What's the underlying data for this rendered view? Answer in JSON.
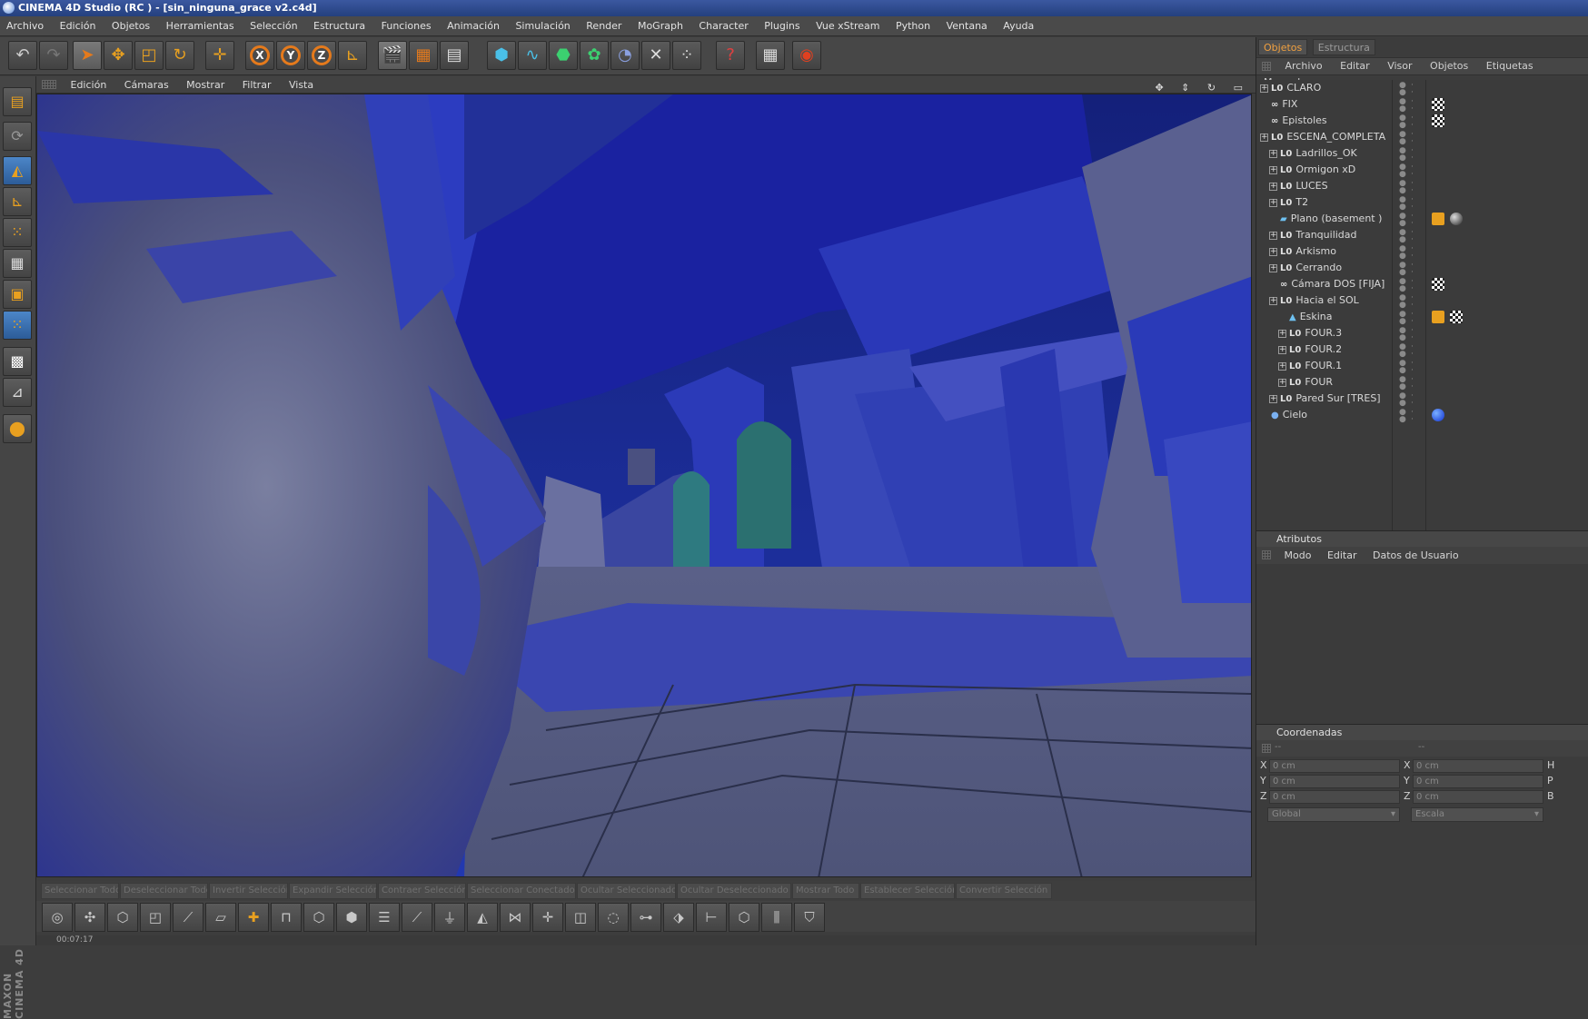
{
  "window": {
    "title": "CINEMA 4D Studio (RC ) - [sin_ninguna_grace v2.c4d]"
  },
  "menu": [
    "Archivo",
    "Edición",
    "Objetos",
    "Herramientas",
    "Selección",
    "Estructura",
    "Funciones",
    "Animación",
    "Simulación",
    "Render",
    "MoGraph",
    "Character",
    "Plugins",
    "Vue xStream",
    "Python",
    "Ventana",
    "Ayuda"
  ],
  "viewport_menu": [
    "Edición",
    "Cámaras",
    "Mostrar",
    "Filtrar",
    "Vista"
  ],
  "selection_bar": [
    "Seleccionar Todo",
    "Deseleccionar Todo",
    "Invertir Selección",
    "Expandir Selección",
    "Contraer Selección",
    "Seleccionar Conectado",
    "Ocultar Seleccionado",
    "Ocultar Deseleccionado",
    "Mostrar Todo",
    "Establecer Selección",
    "Convertir Selección"
  ],
  "status": {
    "time": "00:07:17"
  },
  "left_brand": "MAXON CINEMA 4D",
  "panel_tabs": [
    "Objetos",
    "Estructura"
  ],
  "object_menu": [
    "Archivo",
    "Editar",
    "Visor",
    "Objetos",
    "Etiquetas",
    "Marcadores"
  ],
  "objects": [
    {
      "name": "CLARO",
      "icon": "null-icon",
      "expand": true,
      "indent": 0
    },
    {
      "name": "FIX",
      "icon": "camera-icon",
      "expand": false,
      "indent": 0
    },
    {
      "name": "Epistoles",
      "icon": "camera-icon",
      "expand": false,
      "indent": 0
    },
    {
      "name": "ESCENA_COMPLETA",
      "icon": "null-icon",
      "expand": true,
      "indent": 0
    },
    {
      "name": "Ladrillos_OK",
      "icon": "null-icon",
      "expand": true,
      "indent": 1
    },
    {
      "name": "Ormigon xD",
      "icon": "null-icon",
      "expand": true,
      "indent": 1
    },
    {
      "name": "LUCES",
      "icon": "null-icon",
      "expand": true,
      "indent": 1
    },
    {
      "name": "T2",
      "icon": "null-icon",
      "expand": true,
      "indent": 1
    },
    {
      "name": "Plano (basement )",
      "icon": "plane-icon",
      "expand": false,
      "indent": 1
    },
    {
      "name": "Tranquilidad",
      "icon": "null-icon",
      "expand": true,
      "indent": 1
    },
    {
      "name": "Arkismo",
      "icon": "null-icon",
      "expand": true,
      "indent": 1
    },
    {
      "name": "Cerrando",
      "icon": "null-icon",
      "expand": true,
      "indent": 1
    },
    {
      "name": "Cámara DOS  [FIJA]",
      "icon": "camera-icon",
      "expand": false,
      "indent": 1
    },
    {
      "name": "Hacia el SOL",
      "icon": "null-icon",
      "expand": true,
      "indent": 1
    },
    {
      "name": "Eskina",
      "icon": "polygon-icon",
      "expand": false,
      "indent": 2
    },
    {
      "name": "FOUR.3",
      "icon": "null-icon",
      "expand": true,
      "indent": 2
    },
    {
      "name": "FOUR.2",
      "icon": "null-icon",
      "expand": true,
      "indent": 2
    },
    {
      "name": "FOUR.1",
      "icon": "null-icon",
      "expand": true,
      "indent": 2
    },
    {
      "name": "FOUR",
      "icon": "null-icon",
      "expand": true,
      "indent": 2
    },
    {
      "name": "Pared Sur [TRES]",
      "icon": "null-icon",
      "expand": true,
      "indent": 1
    },
    {
      "name": "Cielo",
      "icon": "sky-icon",
      "expand": false,
      "indent": 0
    }
  ],
  "attributes": {
    "title": "Atributos",
    "menu": [
      "Modo",
      "Editar",
      "Datos de Usuario"
    ]
  },
  "coordinates": {
    "title": "Coordenadas",
    "sub1": "--",
    "sub2": "--",
    "rows": [
      {
        "axis": "X",
        "pos": "0 cm",
        "axis2": "X",
        "size": "0 cm",
        "axis3": "H"
      },
      {
        "axis": "Y",
        "pos": "0 cm",
        "axis2": "Y",
        "size": "0 cm",
        "axis3": "P"
      },
      {
        "axis": "Z",
        "pos": "0 cm",
        "axis2": "Z",
        "size": "0 cm",
        "axis3": "B"
      }
    ],
    "dropdown1": "Global",
    "dropdown2": "Escala"
  },
  "colors": {
    "accent": "#f0a040",
    "viewport_blue": "#1e2e8a",
    "title_blue": "#2c4a8c"
  }
}
